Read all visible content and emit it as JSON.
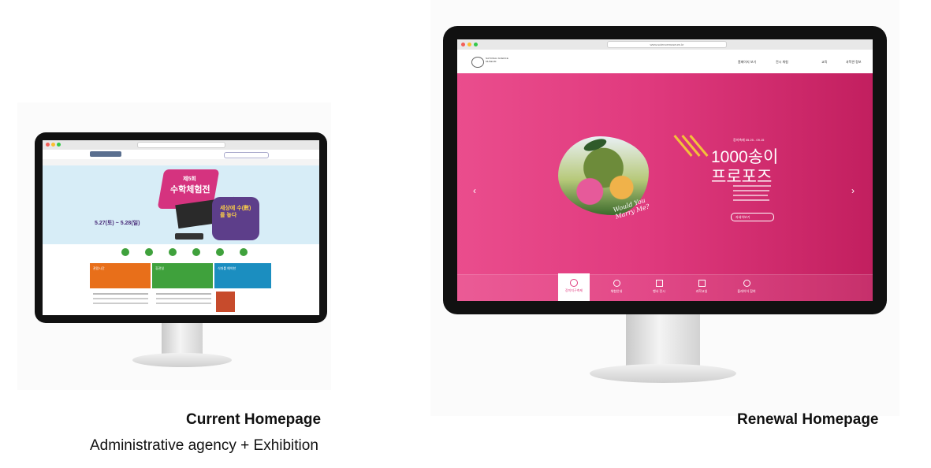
{
  "captions": {
    "left_title": "Current Homepage",
    "left_subtitle": "Administrative agency + Exhibition",
    "right_title": "Renewal Homepage"
  },
  "left_site": {
    "hero_title_line1": "제5회",
    "hero_title_line2": "수학체험전",
    "hero_date": "5.27(토) ~ 5.28(일)",
    "hero_right_text": "세상에 수(數)를 놓다",
    "tiles": [
      {
        "label": "관람시간",
        "color": "#e86f1a"
      },
      {
        "label": "휴관일",
        "color": "#3fa13c"
      },
      {
        "label": "식대를 예약한",
        "color": "#1b8ec0"
      }
    ]
  },
  "right_site": {
    "url": "www.sciencemuseum.kr",
    "logo_text": "NATIONAL SCIENCE MUSEUM",
    "nav": [
      "홈페이지 보기",
      "전시 체험",
      "교육",
      "과학관 정보"
    ],
    "event_date": "장미축제 05.25 - 09.15",
    "headline_line1": "1000송이",
    "headline_line2": "프로포즈",
    "script_text": "Would You Marry Me?",
    "more_button": "자세히보기",
    "strip_items": [
      "장미지구축제",
      "체험안내",
      "행사 전시",
      "과학교실",
      "플레이어 참여"
    ],
    "hero_gradient": [
      "#ea4d8d",
      "#c21f5f"
    ]
  }
}
